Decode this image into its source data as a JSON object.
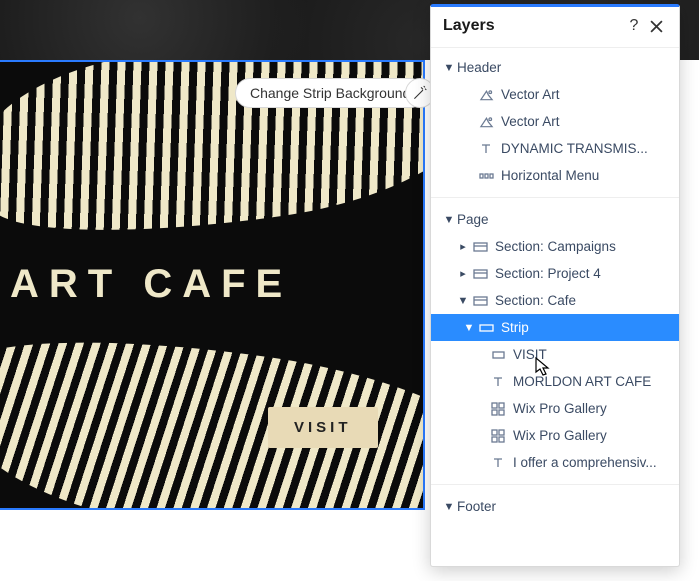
{
  "toolbar": {
    "change_strip_bg_label": "Change Strip Background"
  },
  "strip": {
    "title": "ART CAFE",
    "visit_label": "VISIT"
  },
  "panel": {
    "title": "Layers",
    "groups": {
      "header": {
        "label": "Header",
        "items": [
          {
            "label": "Vector Art",
            "icon": "vector"
          },
          {
            "label": "Vector Art",
            "icon": "vector"
          },
          {
            "label": "DYNAMIC TRANSMIS...",
            "icon": "text"
          },
          {
            "label": "Horizontal Menu",
            "icon": "menu"
          }
        ]
      },
      "page": {
        "label": "Page",
        "sections": [
          {
            "label": "Section: Campaigns",
            "expanded": false
          },
          {
            "label": "Section: Project 4",
            "expanded": false
          },
          {
            "label": "Section: Cafe",
            "expanded": true,
            "strip": {
              "label": "Strip",
              "selected": true,
              "children": [
                {
                  "label": "VISIT",
                  "icon": "container"
                },
                {
                  "label": "MORLDON ART CAFE",
                  "icon": "text"
                },
                {
                  "label": "Wix Pro Gallery",
                  "icon": "gallery"
                },
                {
                  "label": "Wix Pro Gallery",
                  "icon": "gallery"
                },
                {
                  "label": "I offer a comprehensiv...",
                  "icon": "text"
                }
              ]
            }
          }
        ]
      },
      "footer": {
        "label": "Footer"
      }
    }
  }
}
